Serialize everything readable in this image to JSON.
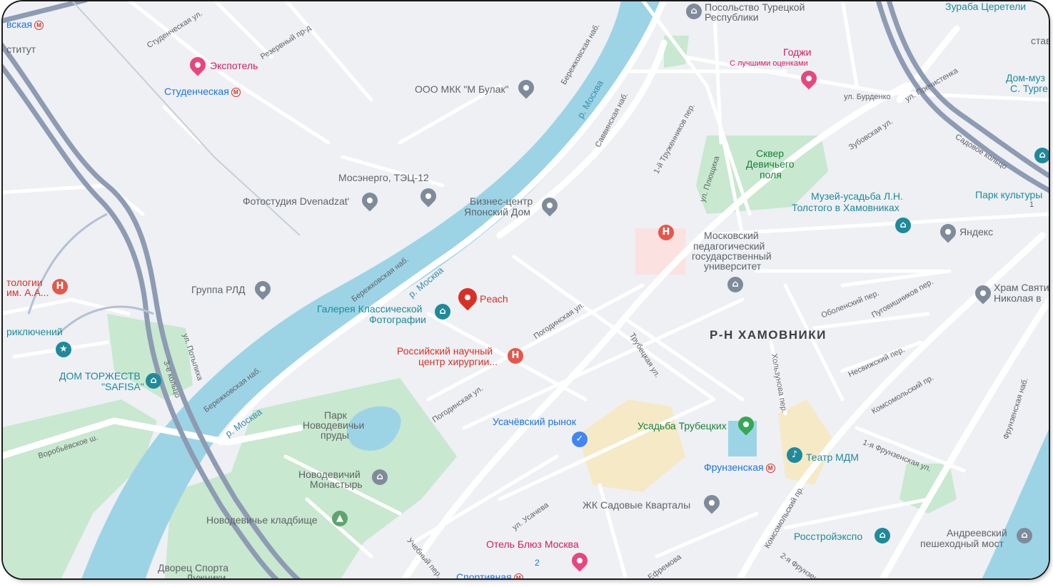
{
  "colors": {
    "water": "#9cd4e6",
    "park": "#c8e8cf",
    "road": "#ffffff",
    "highway": "#8d9bb3",
    "land": "#eef0f4",
    "accent_red": "#d93025"
  },
  "district": "Р-Н ХАМОВНИКИ",
  "selected_place": "Peach",
  "rivers": [
    "р. Москва",
    "р. Москва",
    "р. Москва",
    "р. Москва"
  ],
  "pois": {
    "turkish_embassy_1": "Посольство Турецкой",
    "turkish_embassy_2": "Республики",
    "tsereteli": "Зураба Церетели",
    "godzhi": "Годжи",
    "godzhi_sub": "С лучшими оценками",
    "dom_muz_1": "Дом-муз",
    "dom_muz_2": "С. Турге",
    "expotel": "Экспотель",
    "studencheskaya": "Студенческая",
    "mbulak": "ООО МКК \"М Булак\"",
    "mosenergo": "Мосэнерго, ТЭЦ-12",
    "fotostudia": "Фотостудия Dvenadzat'",
    "bc_1": "Бизнес-центр",
    "bc_2": "Японский Дом",
    "skver_1": "Сквер",
    "skver_2": "Девичьего",
    "skver_3": "поля",
    "tolstoy_1": "Музей-усадьба Л.Н.",
    "tolstoy_2": "Толстого в Хамовниках",
    "park_kult": "Парк культуры",
    "yandex": "Яндекс",
    "mpgu_1": "Московский",
    "mpgu_2": "педагогический",
    "mpgu_3": "государственный",
    "mpgu_4": "университет",
    "rld": "Группа РЛД",
    "gallery_1": "Галерея Классической",
    "gallery_2": "Фотографии",
    "surgery_1": "Российский научный",
    "surgery_2": "центр хирургии...",
    "hram_1": "Храм Святи",
    "hram_2": "Николая в",
    "tologii_1": "тологии",
    "tologii_2": "им. А.А...",
    "priklyucheniy": "риключений",
    "dom_torzhestv_1": "ДОМ ТОРЖЕСТВ",
    "dom_torzhestv_2": "\"SAFISA\"",
    "park_nd_1": "Парк",
    "park_nd_2": "Новодевичьи",
    "park_nd_3": "пруды",
    "usachevsky": "Усачёвский рынок",
    "trubetskih": "Усадьба Трубецких",
    "teatr_mdm": "Театр МДМ",
    "frunzenskaya": "Фрунзенская",
    "novodevichiy_1": "Новодевичий",
    "novodevichiy_2": "Монастырь",
    "sadovye": "ЖК Садовые Кварталы",
    "kladbishe": "Новодевичье кладбище",
    "rosstroy": "Росстройэкспо",
    "andreevsky_1": "Андреевский",
    "andreevsky_2": "пешеходный мост",
    "hotel_blues": "Отель Блюз Москва",
    "dvorets_1": "Дворец Спорта",
    "dvorets_2": "Лужники",
    "sportivnaya": "Спортивная",
    "vskaya": "вская",
    "stitut": "ститут",
    "stav": "став",
    "num_2": "2",
    "num_1": "1"
  },
  "streets": [
    "Студенческая ул.",
    "Резервный пр-д",
    "Бережковская наб.",
    "Саввинская наб.",
    "1-й Труженников пер.",
    "ул. Плющиха",
    "ул. Бурденко",
    "ул. Пречистенка",
    "Зубовская ул.",
    "Садовое кольцо",
    "Бережковская наб.",
    "Погодинская ул.",
    "ул. Потылиха",
    "3-е кольцо",
    "Бережковская наб.",
    "Воробьёвское ш.",
    "Погодинская ул.",
    "Трубецкая ул.",
    "Оболенский пер.",
    "Пуговишников пер.",
    "Хользунова пер.",
    "Несвижский пер.",
    "Комсомольский пр.",
    "Фрунзенская наб.",
    "1-я Фрунзенская ул.",
    "Комсомольский пр.",
    "ул. Усачева",
    "Учебный пер.",
    "Ефремова",
    "2-я Фрунзенская"
  ]
}
